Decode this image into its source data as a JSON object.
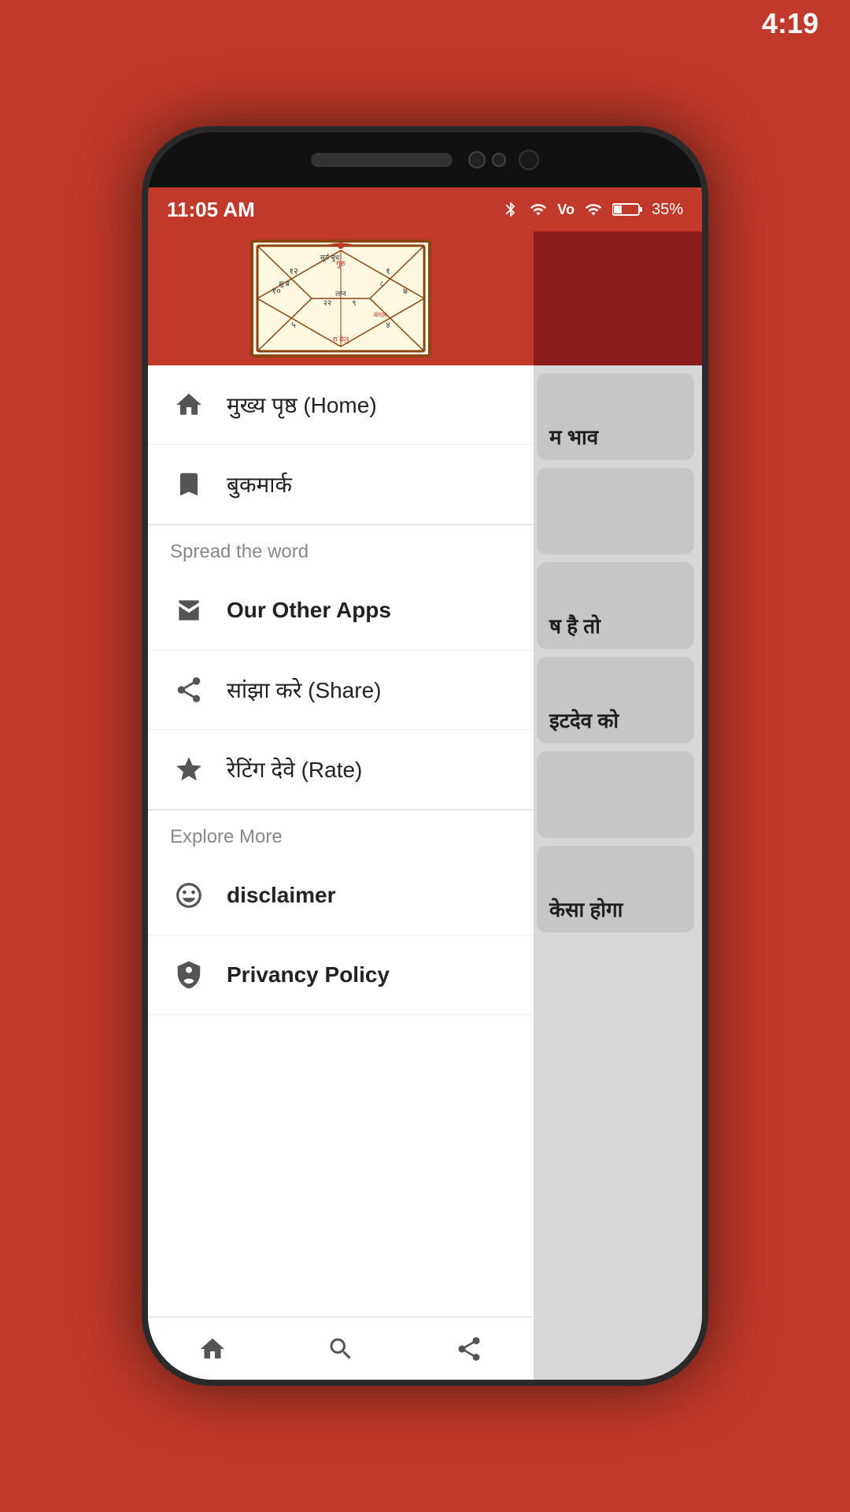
{
  "topBar": {
    "time": "4:19"
  },
  "statusBar": {
    "time": "11:05 AM",
    "battery": "35%",
    "batteryIcon": "battery",
    "wifiIcon": "wifi",
    "signalIcon": "signal",
    "bluetoothIcon": "bluetooth"
  },
  "drawer": {
    "menuItems": [
      {
        "id": "home",
        "icon": "home",
        "label": "मुख्य पृष्ठ (Home)"
      },
      {
        "id": "bookmark",
        "icon": "bookmark",
        "label": "बुकमार्क"
      }
    ],
    "spreadSection": {
      "header": "Spread the word",
      "items": [
        {
          "id": "other-apps",
          "icon": "store",
          "label": "Our Other Apps",
          "bold": true
        },
        {
          "id": "share",
          "icon": "share",
          "label": "सांझा करे (Share)"
        },
        {
          "id": "rate",
          "icon": "star",
          "label": "रेटिंग देवे (Rate)"
        }
      ]
    },
    "exploreSection": {
      "header": "Explore More",
      "items": [
        {
          "id": "disclaimer",
          "icon": "smile",
          "label": "disclaimer",
          "bold": true
        },
        {
          "id": "privacy",
          "icon": "shield",
          "label": "Privancy Policy",
          "bold": true
        }
      ]
    }
  },
  "bgCards": [
    {
      "text": "म भाव"
    },
    {
      "text": ""
    },
    {
      "text": "ष है तो"
    },
    {
      "text": "इटदेव को"
    },
    {
      "text": ""
    },
    {
      "text": "केसा होगा"
    }
  ],
  "bottomNav": [
    {
      "id": "home-nav",
      "icon": "home"
    },
    {
      "id": "search-nav",
      "icon": "search"
    },
    {
      "id": "share-nav",
      "icon": "share"
    }
  ]
}
